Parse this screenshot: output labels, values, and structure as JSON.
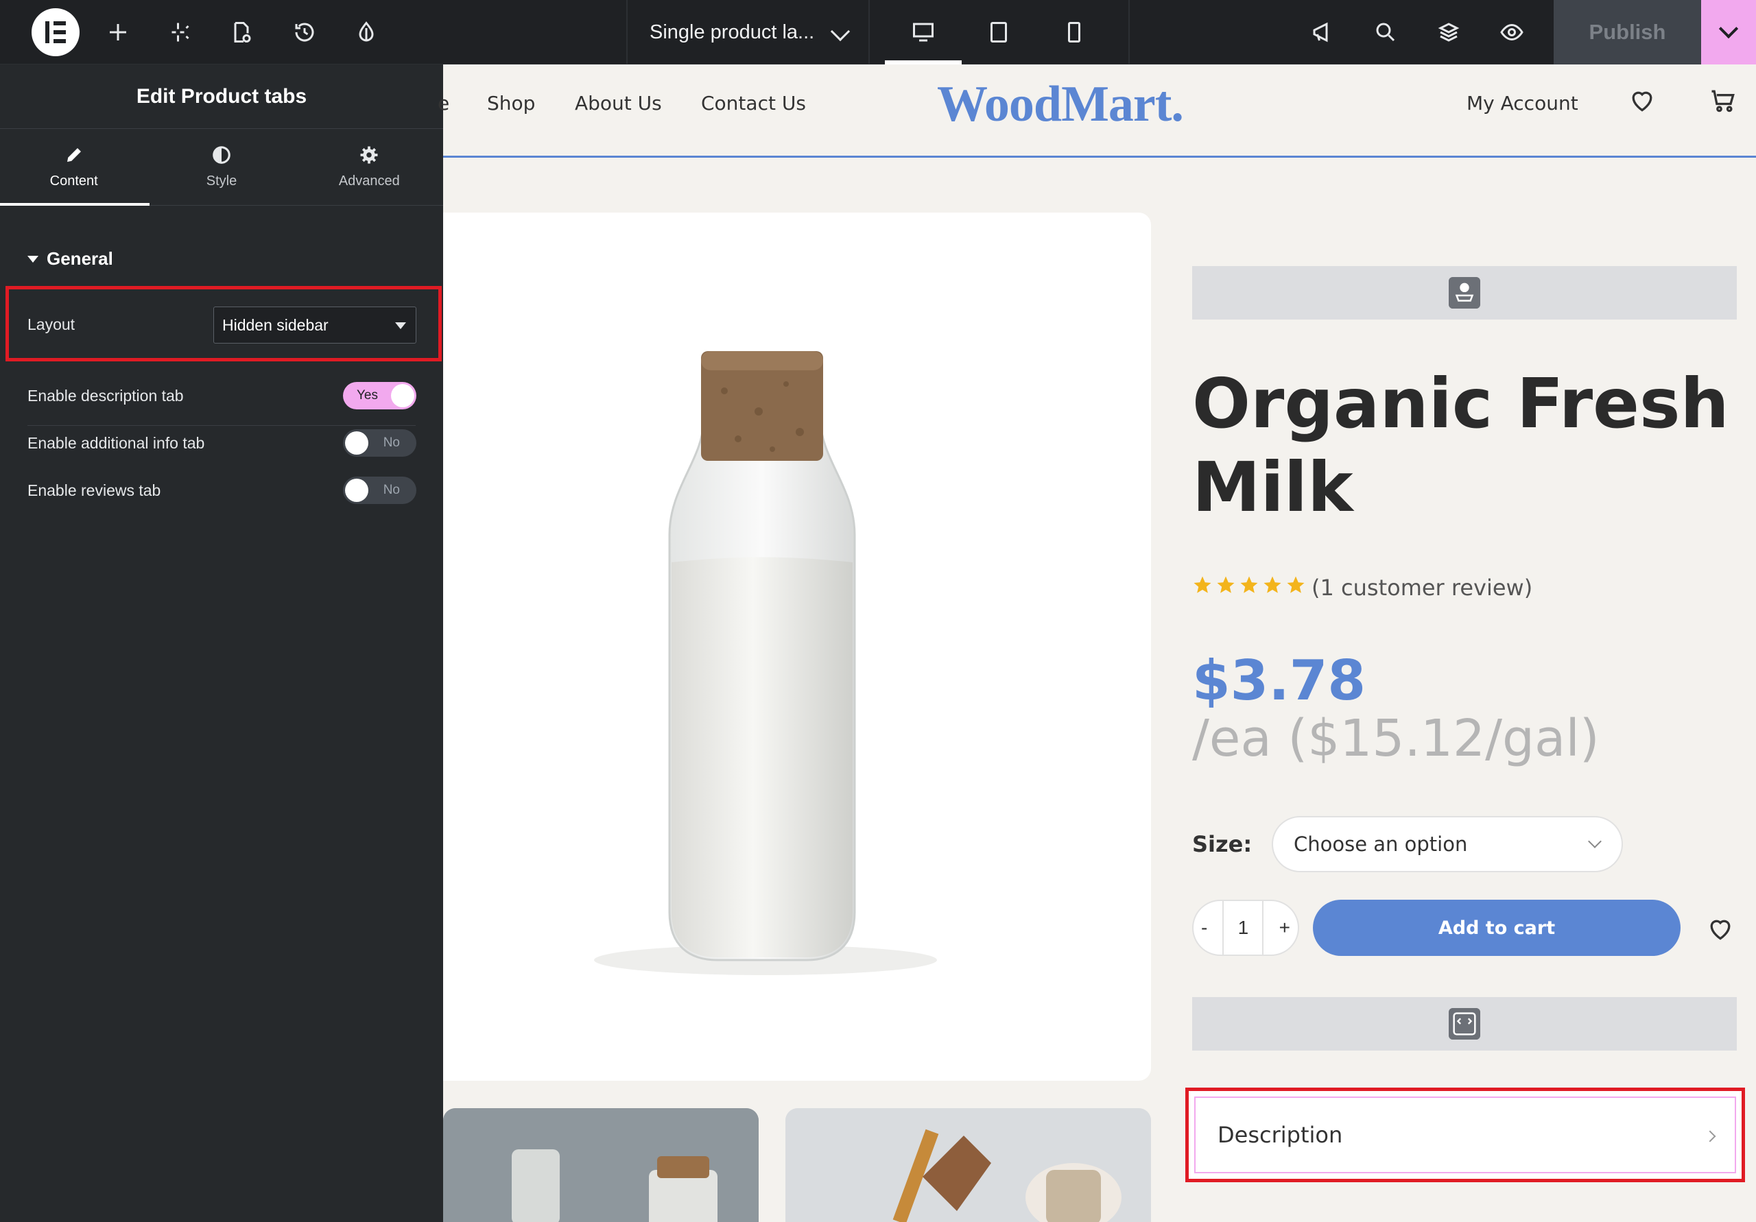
{
  "topbar": {
    "template_name": "Single product la...",
    "publish_label": "Publish",
    "devices": [
      "desktop",
      "tablet",
      "mobile"
    ],
    "active_device": "desktop",
    "accent": "#f2a9ee"
  },
  "panel": {
    "title": "Edit Product tabs",
    "tabs": [
      {
        "label": "Content",
        "icon": "pencil-icon"
      },
      {
        "label": "Style",
        "icon": "half-circle-icon"
      },
      {
        "label": "Advanced",
        "icon": "gear-icon"
      }
    ],
    "active_tab": "Content",
    "section": "General",
    "layout_label": "Layout",
    "layout_value": "Hidden sidebar",
    "toggles": [
      {
        "label": "Enable description tab",
        "state": "Yes"
      },
      {
        "label": "Enable additional info tab",
        "state": "No"
      },
      {
        "label": "Enable reviews tab",
        "state": "No"
      }
    ]
  },
  "site": {
    "nav": [
      "e",
      "Shop",
      "About Us",
      "Contact Us"
    ],
    "brand": "WoodMart.",
    "account": "My Account",
    "brand_color": "#5b86d3"
  },
  "product": {
    "title": "Organic Fresh Milk",
    "rating": 5,
    "review_text": "(1 customer review)",
    "price": "$3.78",
    "unit_price": "/ea ($15.12/gal)",
    "size_label": "Size:",
    "size_placeholder": "Choose an option",
    "qty_minus": "-",
    "qty_value": "1",
    "qty_plus": "+",
    "add_to_cart": "Add to cart",
    "tab_description": "Description"
  }
}
